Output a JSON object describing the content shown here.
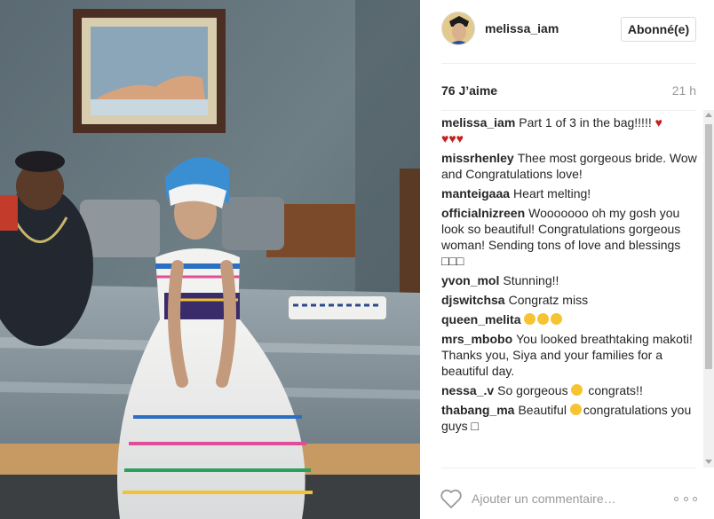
{
  "post": {
    "photo_alt": "photo",
    "author": "melissa_iam",
    "follow_label": "Abonné(e)",
    "likes": "76 J’aime",
    "time": "21 h"
  },
  "comments": [
    {
      "user": "melissa_iam",
      "text": "Part 1 of 3 in the bag!!!!! ",
      "trail": "hearts"
    },
    {
      "user": "missrhenley",
      "text": "Thee most gorgeous bride. Wow and Congratulations love!"
    },
    {
      "user": "manteigaaa",
      "text": "Heart melting!"
    },
    {
      "user": "officialnizreen",
      "text": "Wooooooo oh my gosh you look so beautiful! Congratulations gorgeous woman! Sending tons of love and blessings □□□"
    },
    {
      "user": "yvon_mol",
      "text": "Stunning!!"
    },
    {
      "user": "djswitchsa",
      "text": "Congratz miss"
    },
    {
      "user": "queen_melita",
      "text": "",
      "trail": "three-smileys"
    },
    {
      "user": "mrs_mbobo",
      "text": "You looked breathtaking makoti! Thanks you, Siya and your families for a beautiful day."
    },
    {
      "user": "nessa_.v",
      "text": "So gorgeous ",
      "text2": " congrats!!",
      "trail": "mid-smiley"
    },
    {
      "user": "thabang_ma",
      "text": "Beautiful ",
      "text2": "congratulations you guys □",
      "trail": "mid-smiley"
    }
  ],
  "icons": {
    "heart_trail": "heart-icon",
    "smiley": "smiley-icon",
    "like": "heart-outline-icon",
    "more": "more-options-icon"
  },
  "footer": {
    "comment_placeholder": "Ajouter un commentaire…"
  },
  "colors": {
    "heart": "#c81e1e",
    "muted": "#999999",
    "text": "#262626",
    "border": "#dbdbdb"
  }
}
